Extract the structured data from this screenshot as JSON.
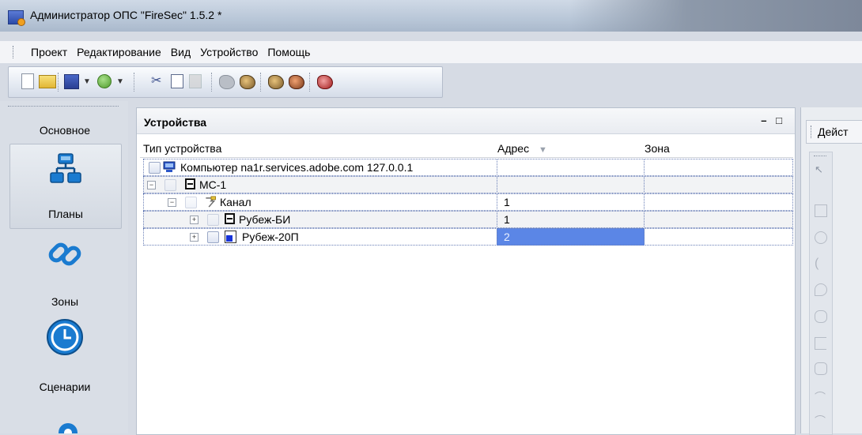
{
  "window": {
    "title": "Администратор ОПС \"FireSec\" 1.5.2 *"
  },
  "menu": {
    "items": [
      "Проект",
      "Редактирование",
      "Вид",
      "Устройство",
      "Помощь"
    ]
  },
  "nav": {
    "main_label": "Основное",
    "plans_label": "Планы",
    "zones_label": "Зоны",
    "scenarios_label": "Сценарии"
  },
  "devices_panel": {
    "title": "Устройства",
    "columns": {
      "type": "Тип устройства",
      "address": "Адрес",
      "zone": "Зона"
    },
    "rows": [
      {
        "name": "Компьютер na1r.services.adobe.com 127.0.0.1",
        "address": "",
        "zone": ""
      },
      {
        "name": "МС-1",
        "address": "",
        "zone": ""
      },
      {
        "name": "Канал",
        "address": "1",
        "zone": ""
      },
      {
        "name": "Рубеж-БИ",
        "address": "1",
        "zone": ""
      },
      {
        "name": "Рубеж-20П",
        "address": "2",
        "zone": ""
      }
    ]
  },
  "right_panel": {
    "tab_label": "Дейст"
  },
  "colors": {
    "selection": "#5b86e6",
    "accent": "#1a7bd0"
  }
}
